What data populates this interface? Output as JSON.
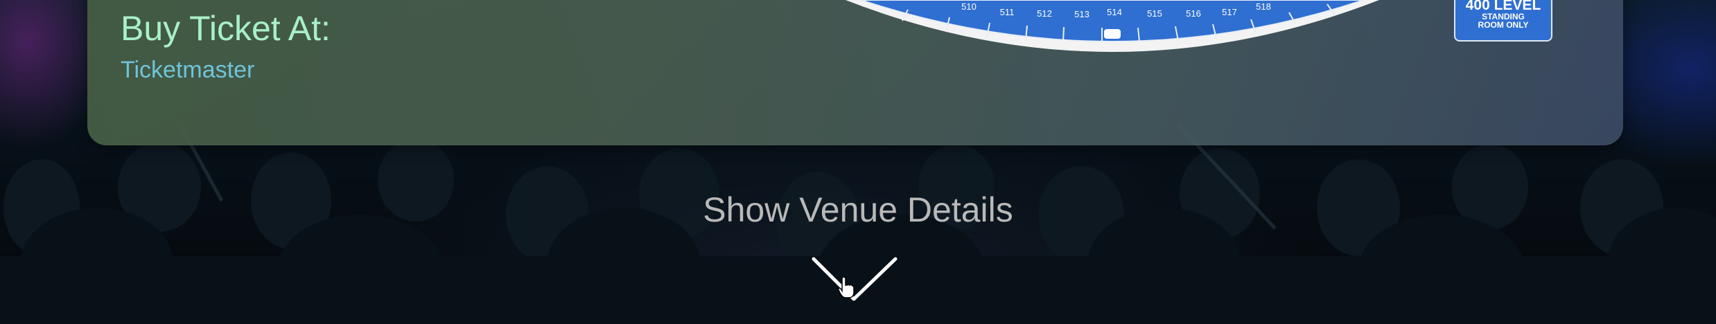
{
  "ticket": {
    "heading": "Buy Ticket At:",
    "vendor": "Ticketmaster"
  },
  "seat_map": {
    "sections": [
      "510",
      "511",
      "512",
      "513",
      "514",
      "515",
      "516",
      "517",
      "518"
    ],
    "level_box": {
      "title": "400 LEVEL",
      "line1": "STANDING",
      "line2": "ROOM ONLY"
    },
    "section_color": "#2f6fd1"
  },
  "venue": {
    "toggle_label": "Show Venue Details",
    "toggle_icon": "chevron-down-icon"
  },
  "colors": {
    "heading": "#a8f0c8",
    "link": "#6fc4d8",
    "toggle_text": "#b9b9b9"
  }
}
